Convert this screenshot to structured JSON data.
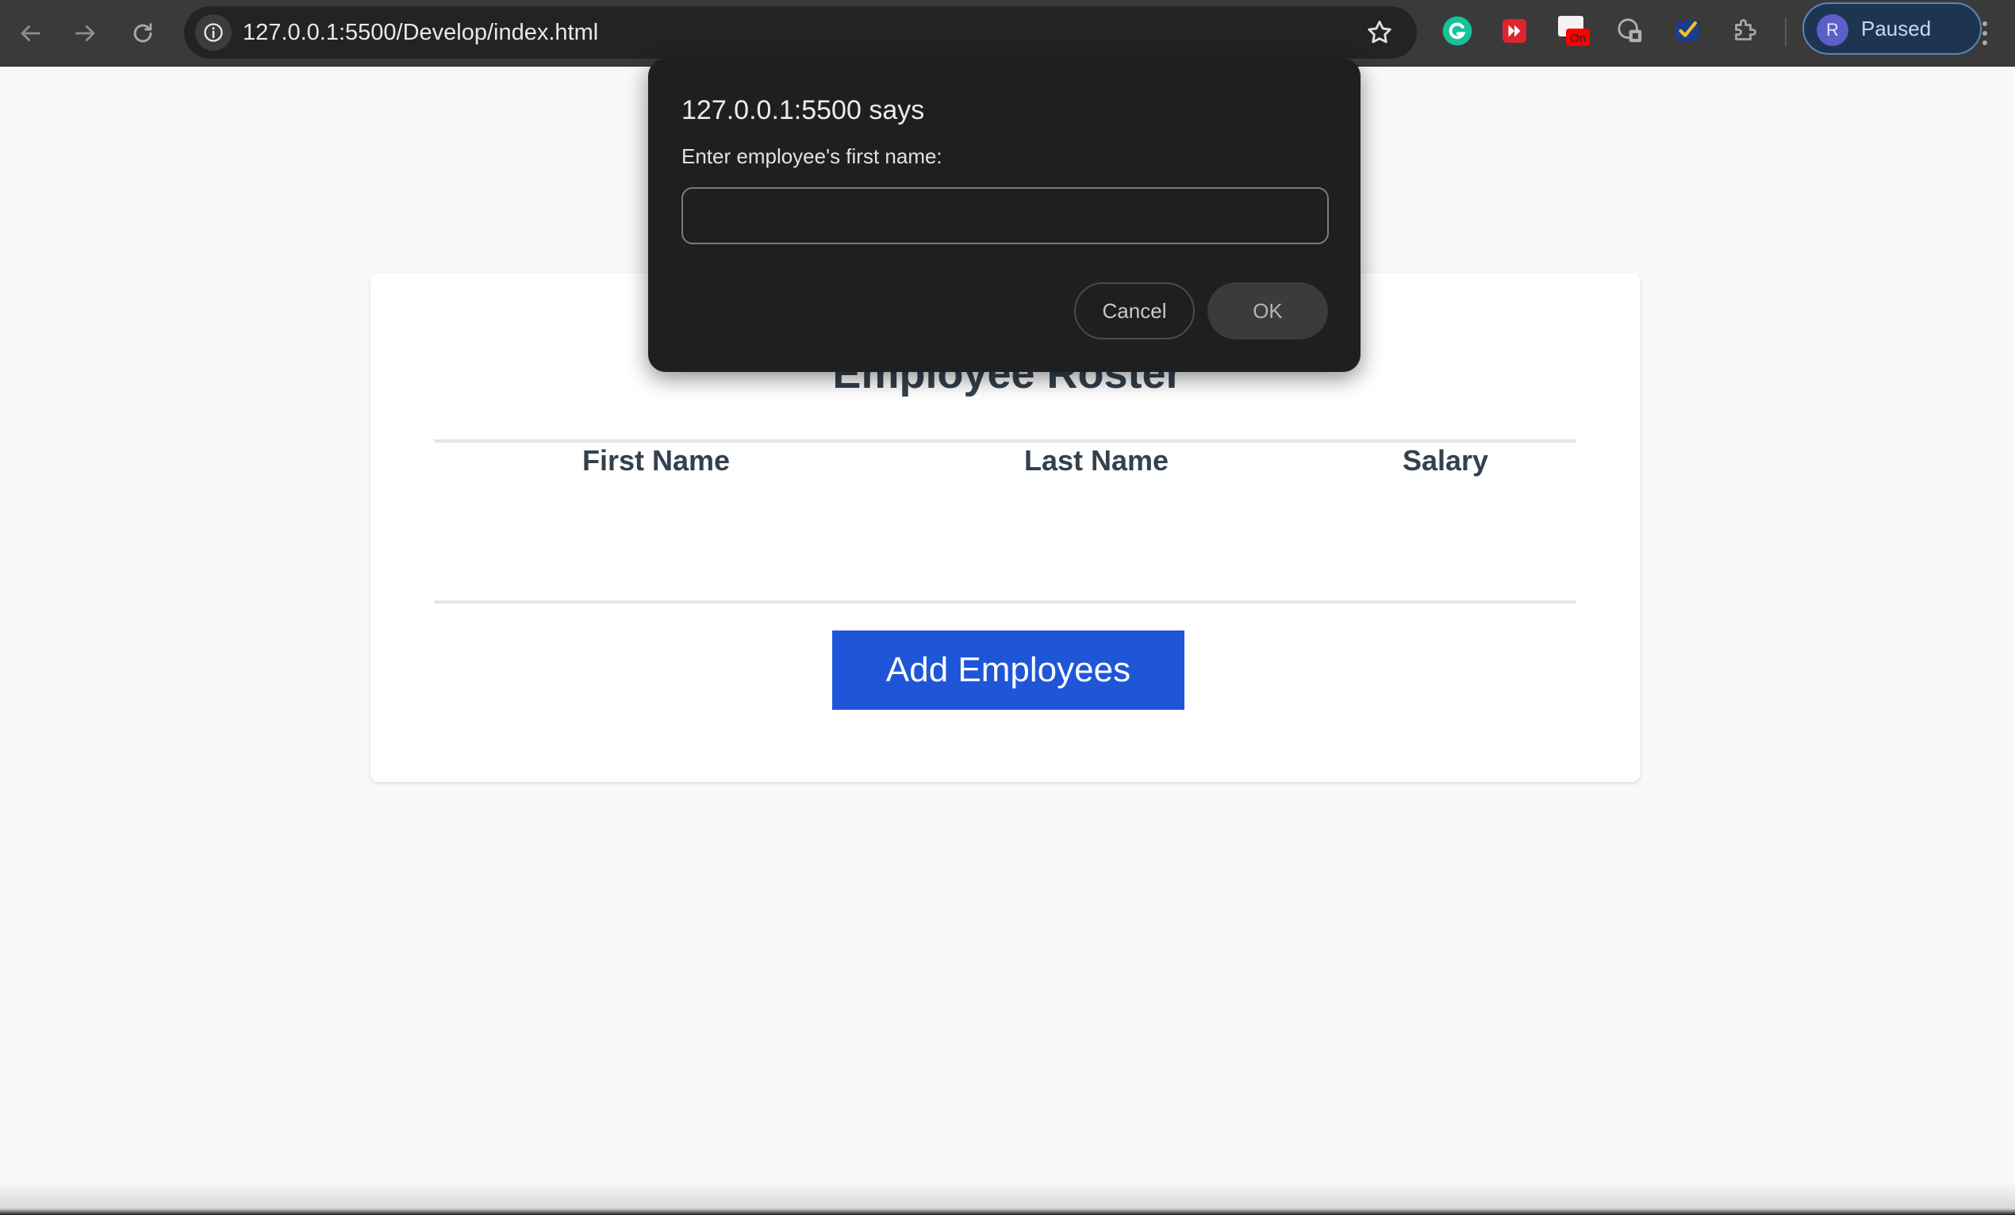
{
  "browser": {
    "url": "127.0.0.1:5500/Develop/index.html",
    "profile_initial": "R",
    "profile_status": "Paused",
    "extensions": [
      {
        "name": "grammarly-icon",
        "color": "#15c39a"
      },
      {
        "name": "media-extension-icon",
        "color": "#e0242c"
      },
      {
        "name": "on-badge-extension-icon",
        "badge": "On",
        "color": "#ff0000"
      },
      {
        "name": "translate-extension-icon",
        "color": "#b0b0b0"
      },
      {
        "name": "checkmark-extension-icon",
        "color": "#f0c419"
      },
      {
        "name": "puzzle-extensions-icon",
        "color": "#a9a9a9"
      }
    ]
  },
  "page": {
    "title": "Employee Roster",
    "columns": [
      "First Name",
      "Last Name",
      "Salary"
    ],
    "rows": [],
    "add_button_label": "Add Employees",
    "accent_color": "#1f56d8"
  },
  "dialog": {
    "title": "127.0.0.1:5500 says",
    "message": "Enter employee's first name:",
    "input_value": "",
    "cancel_label": "Cancel",
    "ok_label": "OK"
  }
}
